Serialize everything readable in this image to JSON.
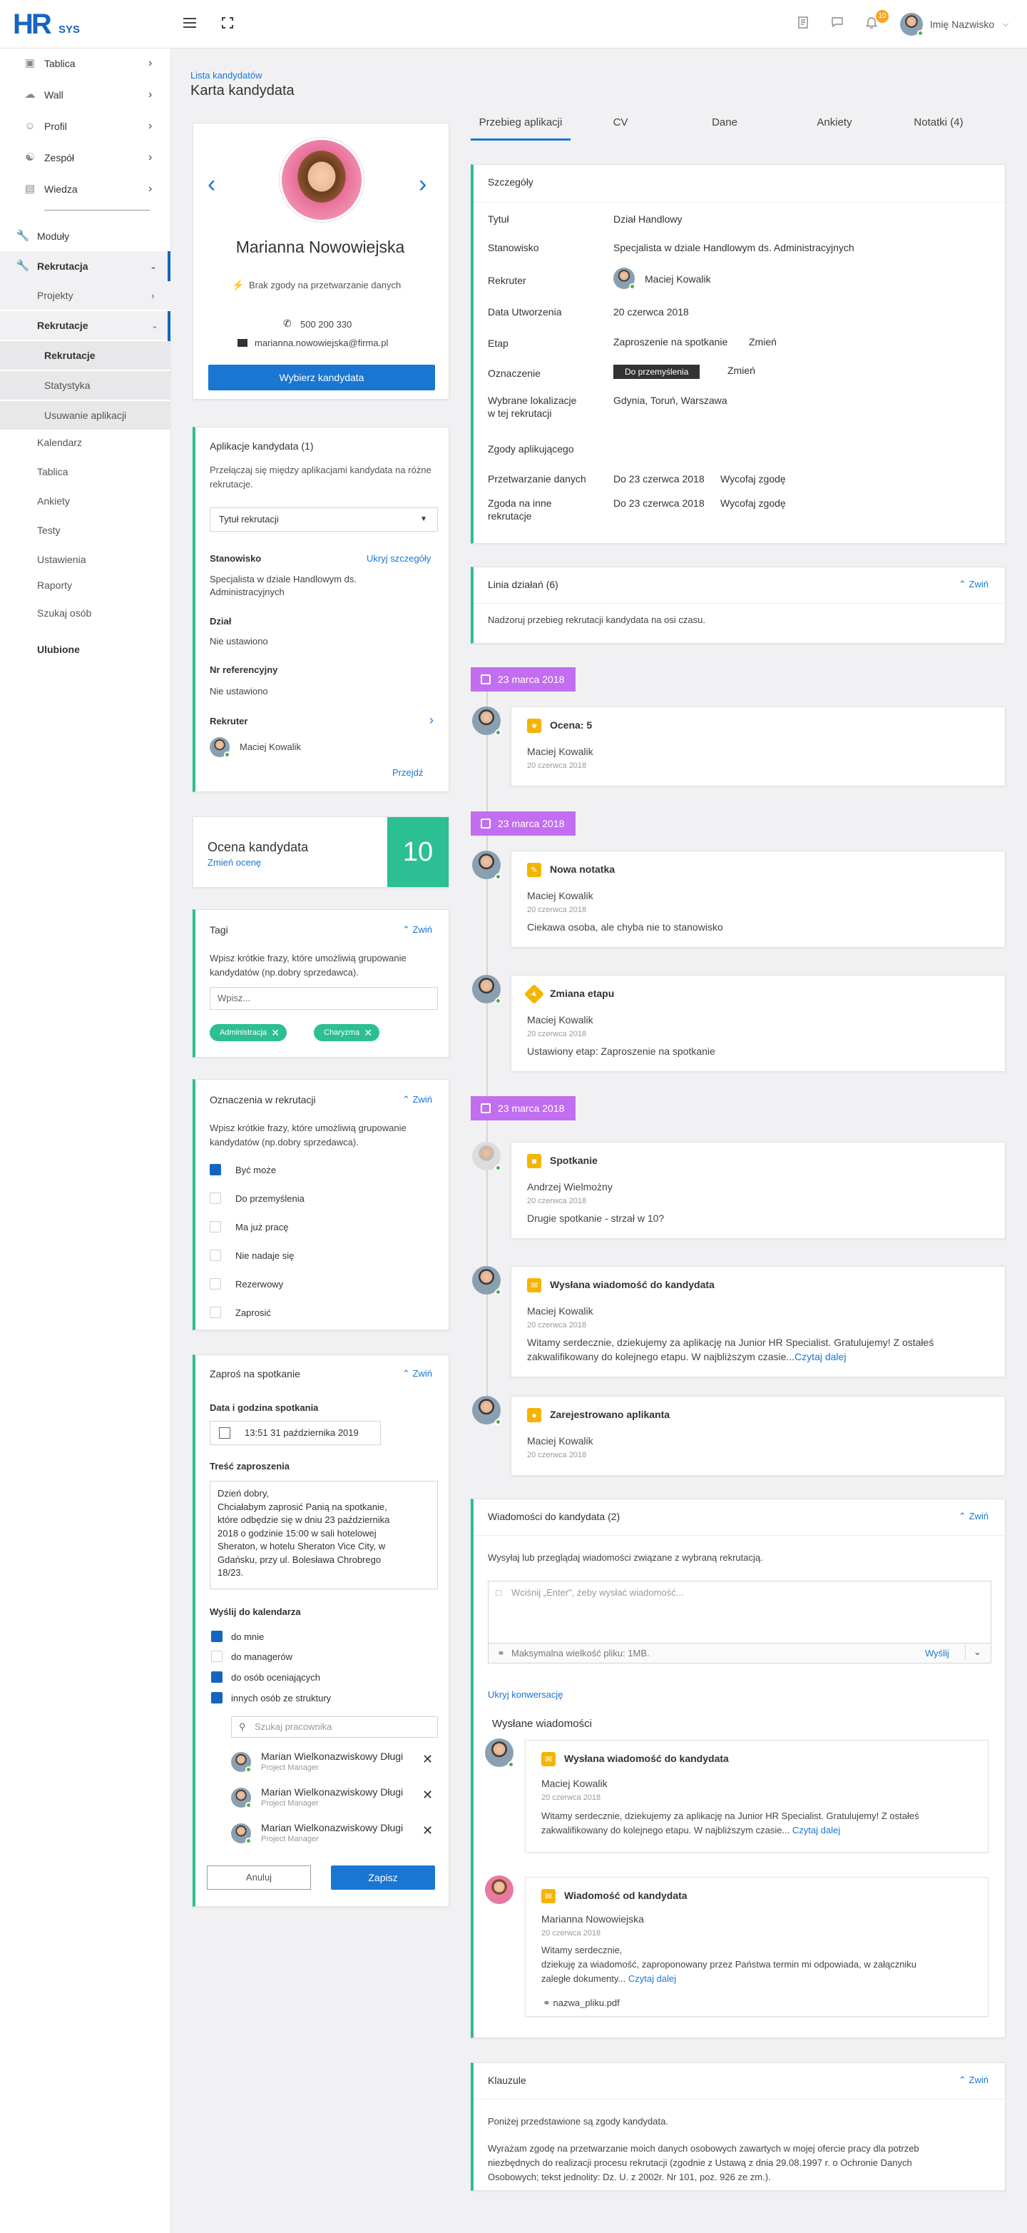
{
  "header": {
    "logo_hr": "HR",
    "logo_sys": "SYS",
    "notif_count": "10",
    "user_name": "Imię Nazwisko",
    "menu_icon": "hamburger-icon",
    "fullscreen_icon": "fullscreen-icon",
    "doc_icon": "document-icon",
    "chat_icon": "chat-icon",
    "bell_icon": "bell-icon"
  },
  "sidebar": {
    "items": [
      {
        "label": "Tablica",
        "icon": "monitor-icon"
      },
      {
        "label": "Wall",
        "icon": "cloud-icon"
      },
      {
        "label": "Profil",
        "icon": "user-icon"
      },
      {
        "label": "Zespół",
        "icon": "team-icon"
      },
      {
        "label": "Wiedza",
        "icon": "book-icon"
      }
    ],
    "moduly": "Moduły",
    "rekrutacja": "Rekrutacja",
    "projekty": "Projekty",
    "rekrutacje": "Rekrutacje",
    "sub": [
      "Rekrutacje",
      "Statystyka",
      "Usuwanie aplikacji"
    ],
    "plain": [
      "Kalendarz",
      "Tablica",
      "Ankiety",
      "Testy",
      "Ustawienia",
      "Raporty",
      "Szukaj osób"
    ],
    "ulubione": "Ulubione"
  },
  "page": {
    "breadcrumb": "Lista kandydatów",
    "title": "Karta kandydata"
  },
  "profile": {
    "name": "Marianna Nowowiejska",
    "consent": "Brak zgody na przetwarzanie danych",
    "phone": "500 200 330",
    "email": "marianna.nowowiejska@firma.pl",
    "select_btn": "Wybierz kandydata"
  },
  "applications": {
    "title": "Aplikacje kandydata (1)",
    "desc": "Przełączaj się między aplikacjami kandydata na różne rekrutacje.",
    "select": "Tytuł rekrutacji",
    "stanowisko_label": "Stanowisko",
    "hide": "Ukryj szczegóły",
    "stanowisko": "Specjalista w dziale Handlowym ds. Administracyjnych",
    "dzial_label": "Dział",
    "dzial": "Nie ustawiono",
    "nr_label": "Nr referencyjny",
    "nr": "Nie ustawiono",
    "rekruter_label": "Rekruter",
    "rekruter": "Maciej Kowalik",
    "go": "Przejdź"
  },
  "rating": {
    "label": "Ocena kandydata",
    "change": "Zmień ocenę",
    "value": "10"
  },
  "tags": {
    "title": "Tagi",
    "collapse": "Zwiń",
    "desc": "Wpisz krótkie frazy, które umożliwią grupowanie kandydatów (np.dobry sprzedawca).",
    "placeholder": "Wpisz...",
    "items": [
      "Administracja",
      "Charyzma"
    ]
  },
  "marks": {
    "title": "Oznaczenia w rekrutacji",
    "collapse": "Zwiń",
    "desc": "Wpisz krótkie frazy, które umożliwią grupowanie kandydatów (np.dobry sprzedawca).",
    "options": [
      "Być może",
      "Do przemyślenia",
      "Ma już pracę",
      "Nie nadaje się",
      "Rezerwowy",
      "Zaprosić"
    ]
  },
  "invite": {
    "title": "Zaproś na spotkanie",
    "collapse": "Zwiń",
    "date_label": "Data i godzina spotkania",
    "date": "13:51 31 października 2019",
    "content_label": "Treść zaproszenia",
    "content": [
      "Dzień dobry,",
      "Chciałabym zaprosić Panią na spotkanie,",
      "które odbędzie się w dniu 23 października",
      "2018 o godzinie 15:00 w sali hotelowej",
      "Sheraton, w hotelu Sheraton Vice City, w",
      "Gdańsku, przy ul. Bolesława Chrobrego",
      "18/23."
    ],
    "send_label": "Wyślij do kalendarza",
    "send": [
      "do mnie",
      "do managerów",
      "do osób oceniających",
      "innych osób ze struktury"
    ],
    "search": "Szukaj pracownika",
    "employees": [
      {
        "name": "Marian Wielkonazwiskowy Długi",
        "role": "Project Manager"
      },
      {
        "name": "Marian Wielkonazwiskowy Długi",
        "role": "Project Manager"
      },
      {
        "name": "Marian Wielkonazwiskowy Długi",
        "role": "Project Manager"
      }
    ],
    "cancel": "Anuluj",
    "save": "Zapisz"
  },
  "tabs": [
    "Przebieg aplikacji",
    "CV",
    "Dane",
    "Ankiety",
    "Notatki (4)"
  ],
  "details": {
    "title": "Szczegóły",
    "rows": {
      "tytul_l": "Tytuł",
      "tytul": "Dział Handlowy",
      "stan_l": "Stanowisko",
      "stan": "Specjalista w dziale Handlowym ds. Administracyjnych",
      "rek_l": "Rekruter",
      "rek": "Maciej Kowalik",
      "data_l": "Data Utworzenia",
      "data": "20 czerwca 2018",
      "etap_l": "Etap",
      "etap": "Zaproszenie na spotkanie",
      "zmien": "Zmień",
      "ozn_l": "Oznaczenie",
      "ozn": "Do przemyślenia",
      "lok_l1": "Wybrane lokalizacje",
      "lok_l2": "w tej rekrutacji",
      "lok": "Gdynia, Toruń, Warszawa",
      "zgody_l": "Zgody aplikującego",
      "prz_l": "Przetwarzanie danych",
      "prz": "Do 23 czerwca 2018",
      "wycofaj": "Wycofaj zgodę",
      "inne_l1": "Zgoda na inne",
      "inne_l2": "rekrutacje",
      "inne": "Do 23 czerwca 2018"
    }
  },
  "timeline": {
    "title": "Linia działań (6)",
    "collapse": "Zwiń",
    "desc": "Nadzoruj przebieg rekrutacji kandydata na osi czasu.",
    "dates": [
      "23 marca 2018",
      "23 marca 2018",
      "23 marca 2018"
    ],
    "events": [
      {
        "title": "Ocena: 5",
        "name": "Maciej Kowalik",
        "date": "20 czerwca 2018",
        "text": "",
        "icon": "star-icon"
      },
      {
        "title": "Nowa notatka",
        "name": "Maciej Kowalik",
        "date": "20 czerwca 2018",
        "text": "Ciekawa osoba, ale chyba nie to stanowisko",
        "icon": "note-icon"
      },
      {
        "title": "Zmiana etapu",
        "name": "Maciej Kowalik",
        "date": "20 czerwca 2018",
        "text": "Ustawiony etap: Zaproszenie na spotkanie",
        "icon": "diamond-arrow-icon"
      },
      {
        "title": "Spotkanie",
        "name": "Andrzej Wielmożny",
        "date": "20 czerwca 2018",
        "text": "Drugie spotkanie - strzał w 10?",
        "icon": "meeting-icon"
      },
      {
        "title": "Wysłana wiadomość do kandydata",
        "name": "Maciej Kowalik",
        "date": "20 czerwca 2018",
        "text1": "Witamy serdecznie, dziekujemy za aplikację na Junior HR Specialist. Gratulujemy! Z ostałeś",
        "text2": "zakwalifikowany do kolejnego etapu. W najbliższym czasie...",
        "more": "Czytaj dalej",
        "icon": "mail-icon"
      },
      {
        "title": "Zarejestrowano aplikanta",
        "name": "Maciej Kowalik",
        "date": "20 czerwca 2018",
        "text": "",
        "icon": "person-icon"
      }
    ]
  },
  "messages": {
    "title": "Wiadomości do kandydata (2)",
    "collapse": "Zwiń",
    "desc": "Wysyłaj lub przeglądaj wiadomości związane z wybraną rekrutacją.",
    "placeholder": "Wciśnij „Enter\", żeby wysłać wiadomość...",
    "attach": "Maksymalna wielkość pliku: 1MB.",
    "send": "Wyślij",
    "hide": "Ukryj konwersację",
    "sent_label": "Wysłane wiadomości",
    "m1": {
      "title": "Wysłana wiadomość do kandydata",
      "name": "Maciej Kowalik",
      "date": "20 czerwca 2018",
      "text1": "Witamy serdecznie, dziekujemy za aplikację na Junior HR Specialist. Gratulujemy! Z ostałeś",
      "text2": "zakwalifikowany do kolejnego etapu. W najbliższym czasie...",
      "more": "Czytaj dalej"
    },
    "m2": {
      "title": "Wiadomość od kandydata",
      "name": "Marianna Nowowiejska",
      "date": "20 czerwca 2018",
      "text1": "Witamy serdecznie,",
      "text2": "dziekuję za wiadomość, zaproponowany przez Państwa termin mi odpowiada, w załączniku",
      "text3": "zaległe dokumenty...",
      "more": "Czytaj dalej",
      "file": "nazwa_pliku.pdf"
    }
  },
  "clauses": {
    "title": "Klauzule",
    "collapse": "Zwiń",
    "line1": "Poniżej przedstawione są zgody kandydata.",
    "line2": "Wyrażam zgodę na przetwarzanie moich danych osobowych zawartych w mojej ofercie pracy dla potrzeb",
    "line3": "niezbędnych do realizacji procesu rekrutacji (zgodnie z Ustawą z dnia 29.08.1997 r. o Ochronie Danych",
    "line4": "Osobowych; tekst jednolity: Dz. U. z 2002r. Nr 101, poz. 926 ze zm.)."
  },
  "colors": {
    "accent": "#1976d2",
    "green": "#2bbf93",
    "purple": "#c26ef0",
    "yellow": "#f5b400"
  }
}
